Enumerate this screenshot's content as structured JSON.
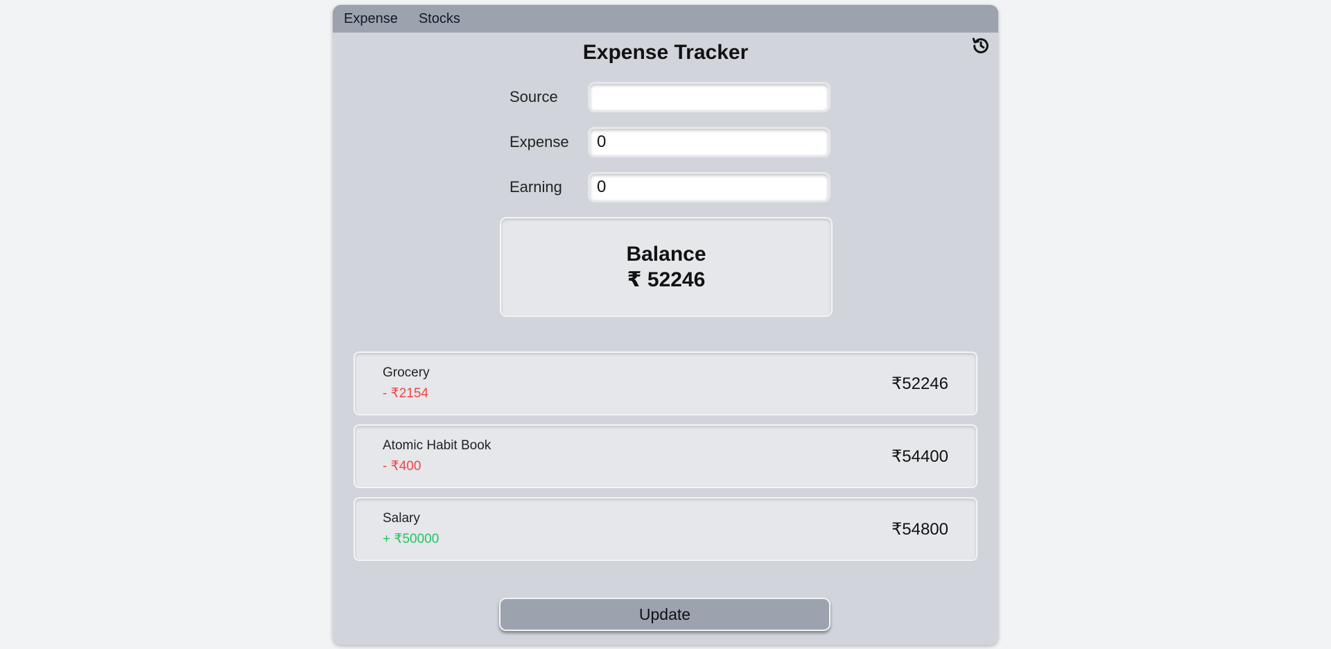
{
  "nav": {
    "tabs": [
      {
        "label": "Expense"
      },
      {
        "label": "Stocks"
      }
    ]
  },
  "header": {
    "title": "Expense Tracker",
    "history_icon": "history-icon"
  },
  "form": {
    "source_label": "Source",
    "source_value": "",
    "expense_label": "Expense",
    "expense_value": "0",
    "earning_label": "Earning",
    "earning_value": "0"
  },
  "balance": {
    "label": "Balance",
    "amount": "₹ 52246"
  },
  "transactions": [
    {
      "name": "Grocery",
      "delta": "- ₹2154",
      "type": "expense",
      "total": "₹52246"
    },
    {
      "name": "Atomic Habit Book",
      "delta": "- ₹400",
      "type": "expense",
      "total": "₹54400"
    },
    {
      "name": "Salary",
      "delta": "+ ₹50000",
      "type": "earning",
      "total": "₹54800"
    }
  ],
  "colors": {
    "expense": "#ef4444",
    "earning": "#22c55e"
  },
  "actions": {
    "update_label": "Update"
  }
}
